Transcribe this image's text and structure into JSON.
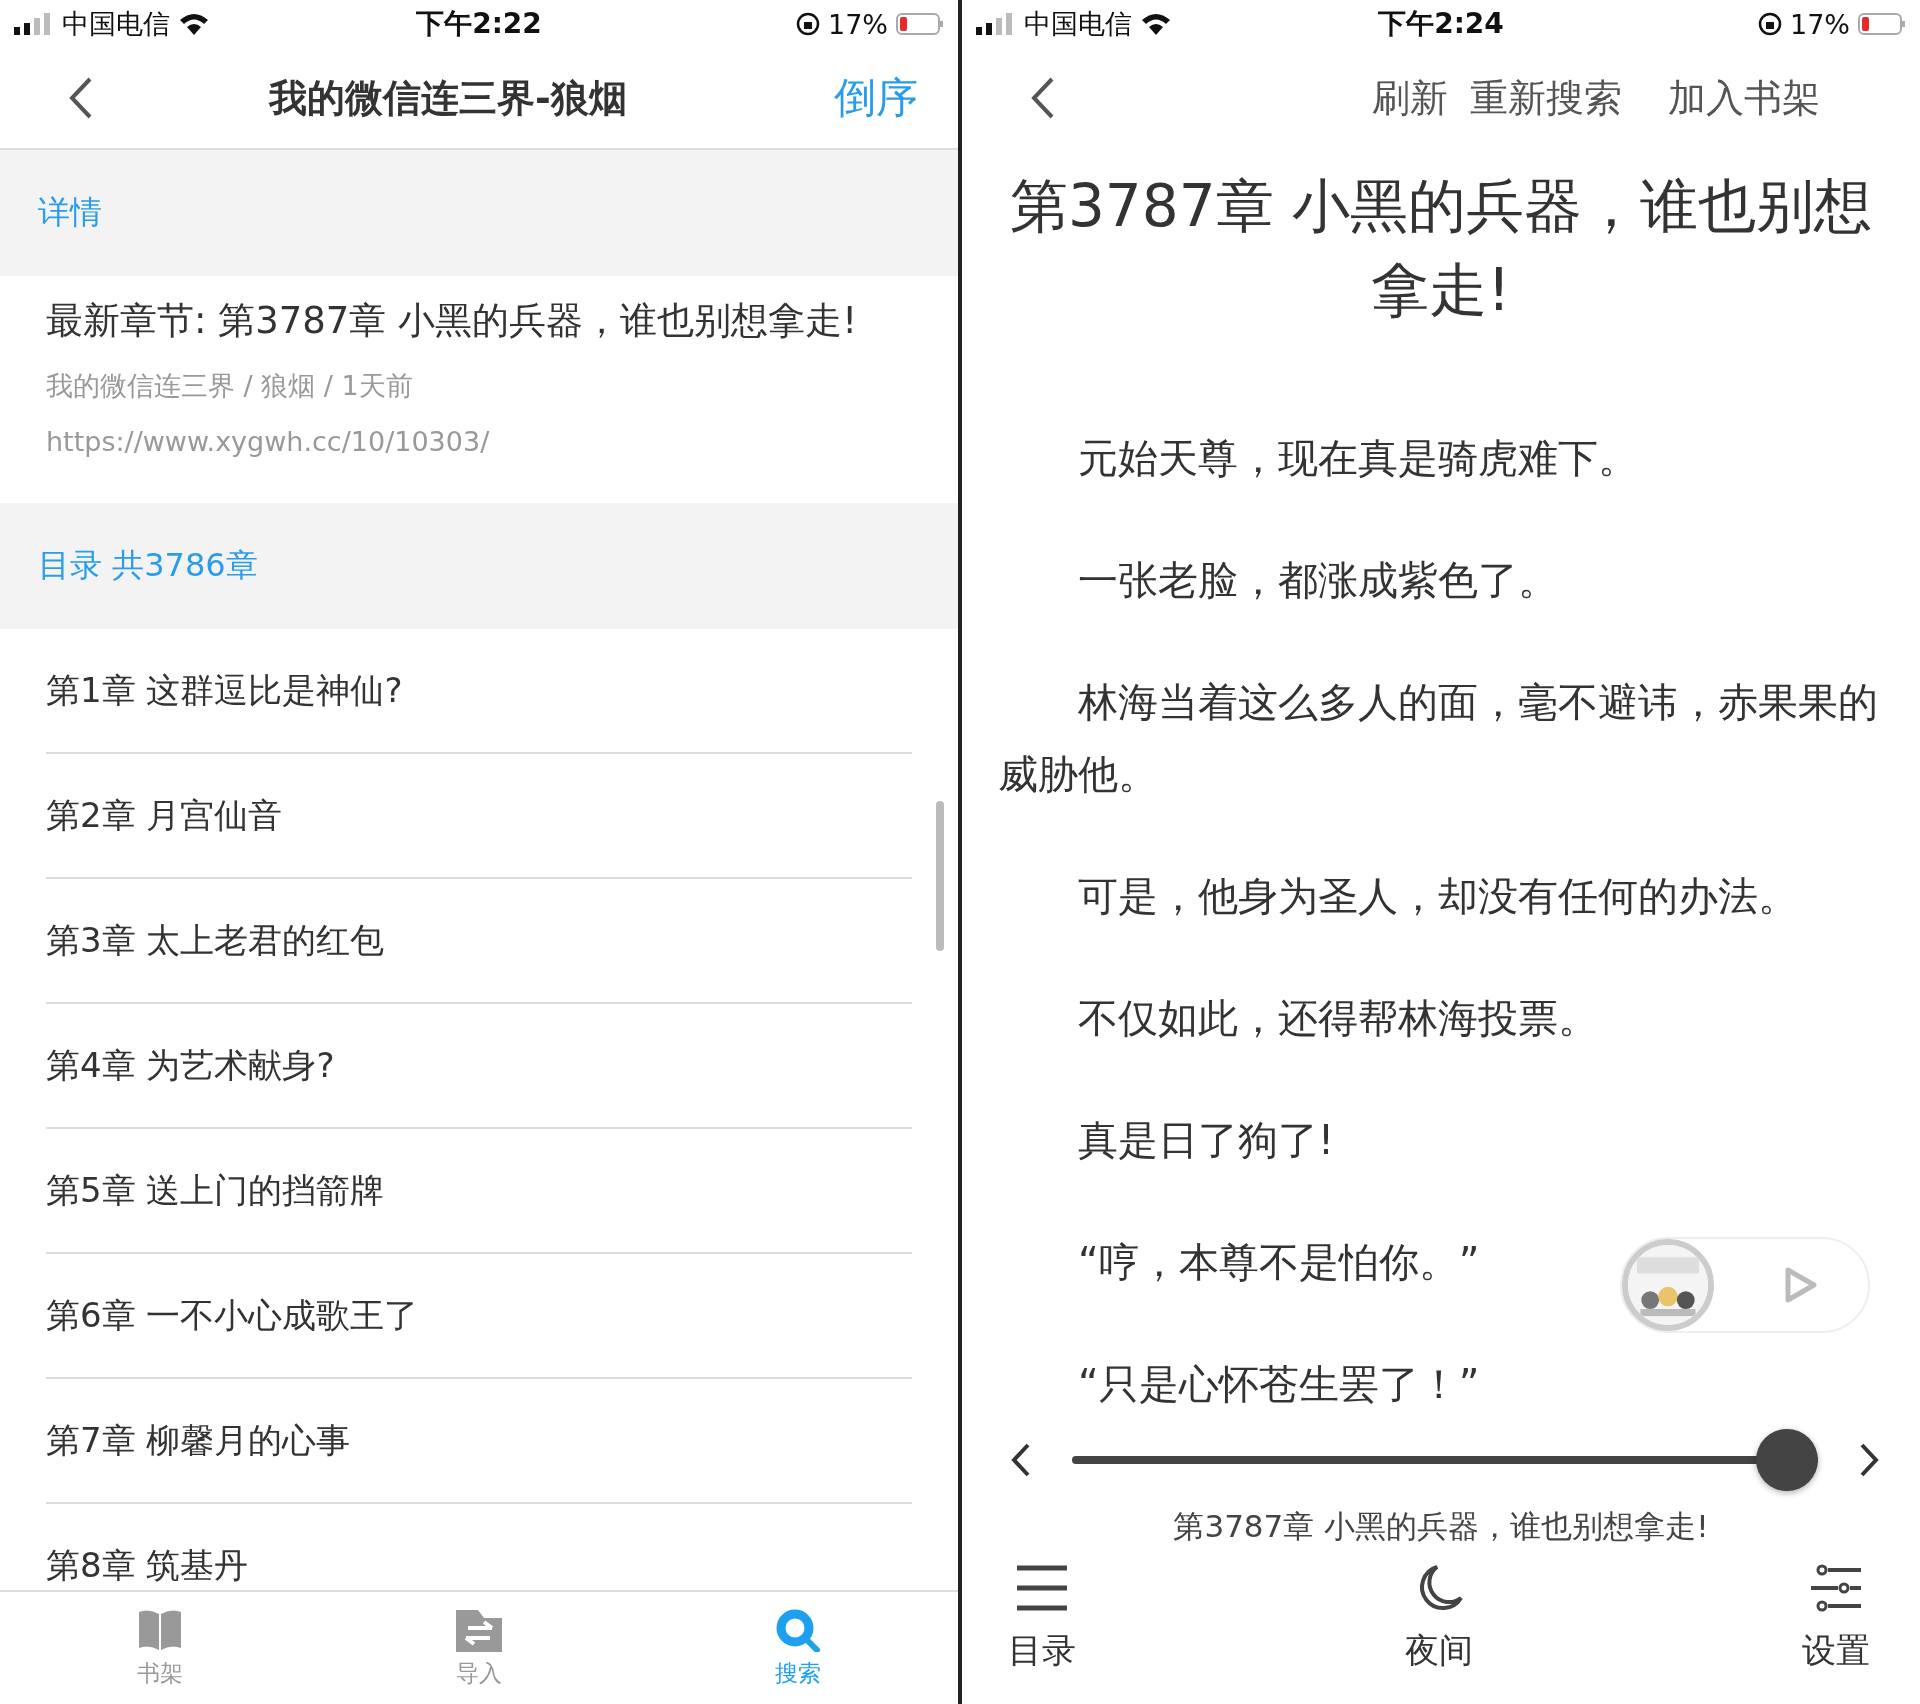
{
  "catalog_screen": {
    "status_bar": {
      "carrier": "中国电信",
      "time": "下午2:22",
      "battery": "17%"
    },
    "nav": {
      "title": "我的微信连三界-狼烟",
      "action": "倒序"
    },
    "details": {
      "header": "详情",
      "latest": "最新章节: 第3787章 小黑的兵器，谁也别想拿走!",
      "meta": "我的微信连三界 / 狼烟 /  1天前",
      "url": "https://www.xygwh.cc/10/10303/"
    },
    "toc": {
      "header": "目录 共3786章",
      "chapters": [
        "第1章 这群逗比是神仙?",
        "第2章 月宫仙音",
        "第3章 太上老君的红包",
        "第4章 为艺术献身?",
        "第5章 送上门的挡箭牌",
        "第6章 一不小心成歌王了",
        "第7章 柳馨月的心事",
        "第8章 筑基丹"
      ]
    },
    "tab_bar": [
      {
        "label": "书架",
        "kind": "shelf",
        "selected": false
      },
      {
        "label": "导入",
        "kind": "import",
        "selected": false
      },
      {
        "label": "搜索",
        "kind": "search",
        "selected": true
      }
    ]
  },
  "reader_screen": {
    "status_bar": {
      "carrier": "中国电信",
      "time": "下午2:24",
      "battery": "17%"
    },
    "nav": {
      "actions": [
        "刷新",
        "重新搜索",
        "加入书架"
      ]
    },
    "chapter_title": "第3787章 小黑的兵器，谁也别想拿走!",
    "paragraphs": [
      "元始天尊，现在真是骑虎难下。",
      "一张老脸，都涨成紫色了。",
      "林海当着这么多人的面，毫不避讳，赤果果的威胁他。",
      "可是，他身为圣人，却没有任何的办法。",
      "不仅如此，还得帮林海投票。",
      "真是日了狗了!",
      "“哼，本尊不是怕你。”",
      "“只是心怀苍生罢了！”"
    ],
    "progress": {
      "level": 1,
      "chapter": "第3787章 小黑的兵器，谁也别想拿走!"
    },
    "toolbar": [
      {
        "label": "目录",
        "kind": "menu"
      },
      {
        "label": "夜间",
        "kind": "night"
      },
      {
        "label": "设置",
        "kind": "settings"
      }
    ]
  }
}
